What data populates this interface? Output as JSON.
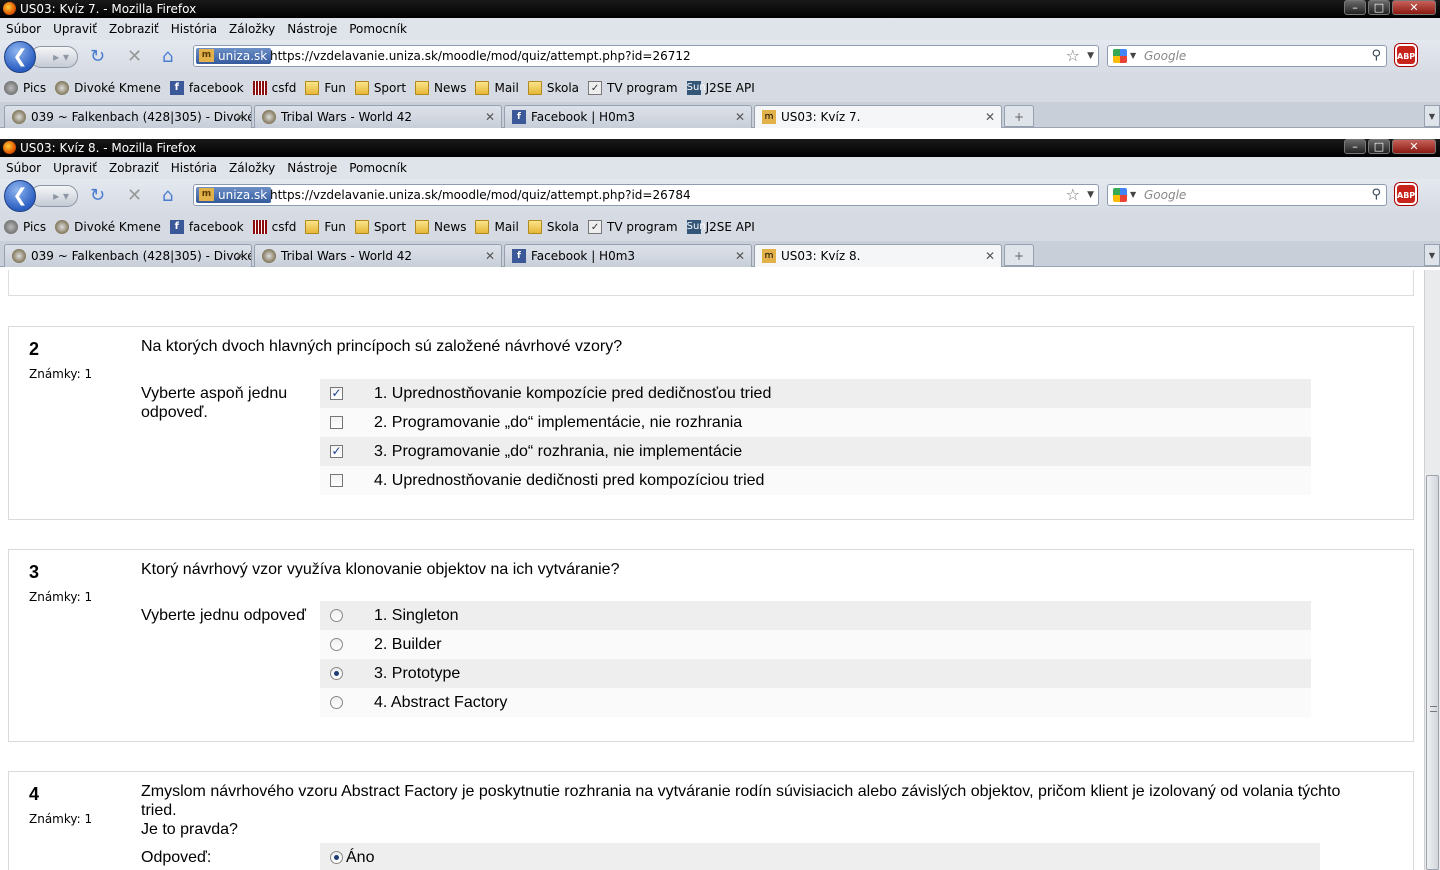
{
  "windows": [
    {
      "title": "US03: Kvíz 7. - Mozilla Firefox",
      "url": "https://vzdelavanie.uniza.sk/moodle/mod/quiz/attempt.php?id=26712",
      "tabs": [
        {
          "label": "039 ~ Falkenbach (428|305) - Divoké...",
          "favicon": "tribal-icon"
        },
        {
          "label": "Tribal Wars - World 42",
          "favicon": "tribal-icon"
        },
        {
          "label": "Facebook | H0m3",
          "favicon": "facebook-icon"
        },
        {
          "label": "US03: Kvíz 7.",
          "favicon": "moodle-icon"
        }
      ]
    },
    {
      "title": "US03: Kvíz 8. - Mozilla Firefox",
      "url": "https://vzdelavanie.uniza.sk/moodle/mod/quiz/attempt.php?id=26784",
      "tabs": [
        {
          "label": "039 ~ Falkenbach (428|305) - Divoké...",
          "favicon": "tribal-icon"
        },
        {
          "label": "Tribal Wars - World 42",
          "favicon": "tribal-icon"
        },
        {
          "label": "Facebook | H0m3",
          "favicon": "facebook-icon"
        },
        {
          "label": "US03: Kvíz 8.",
          "favicon": "moodle-icon"
        }
      ]
    }
  ],
  "menu": [
    "Súbor",
    "Upraviť",
    "Zobraziť",
    "História",
    "Záložky",
    "Nástroje",
    "Pomocník"
  ],
  "site_badge": "uniza.sk",
  "search_placeholder": "Google",
  "abp_label": "ABP",
  "bookmarks": [
    "Pics",
    "Divoké Kmene",
    "facebook",
    "csfd",
    "Fun",
    "Sport",
    "News",
    "Mail",
    "Skola",
    "TV program",
    "J2SE API"
  ],
  "quiz": {
    "q2": {
      "number": "2",
      "marks": "Známky: 1",
      "text": "Na ktorých dvoch hlavných princípoch sú založené návrhové vzory?",
      "prompt": "Vyberte aspoň jednu odpoveď.",
      "options": [
        {
          "label": "1. Uprednostňovanie kompozície pred dedičnosťou tried",
          "checked": true
        },
        {
          "label": "2. Programovanie „do“ implementácie, nie rozhrania",
          "checked": false
        },
        {
          "label": "3. Programovanie „do“ rozhrania, nie implementácie",
          "checked": true
        },
        {
          "label": "4. Uprednostňovanie dedičnosti pred kompozíciou tried",
          "checked": false
        }
      ]
    },
    "q3": {
      "number": "3",
      "marks": "Známky: 1",
      "text": "Ktorý návrhový vzor využíva klonovanie objektov na ich vytváranie?",
      "prompt": "Vyberte jednu odpoveď",
      "options": [
        {
          "label": "1. Singleton",
          "selected": false
        },
        {
          "label": "2. Builder",
          "selected": false
        },
        {
          "label": "3. Prototype",
          "selected": true
        },
        {
          "label": "4. Abstract Factory",
          "selected": false
        }
      ]
    },
    "q4": {
      "number": "4",
      "marks": "Známky: 1",
      "text_line1": "Zmyslom návrhového vzoru Abstract Factory je poskytnutie rozhrania na vytváranie rodín súvisiacich alebo závislých objektov, pričom klient je izolovaný od volania týchto tried.",
      "text_line2": "Je to pravda?",
      "prompt": "Odpoveď:",
      "options": [
        {
          "label": "Áno",
          "selected": true
        }
      ]
    }
  }
}
